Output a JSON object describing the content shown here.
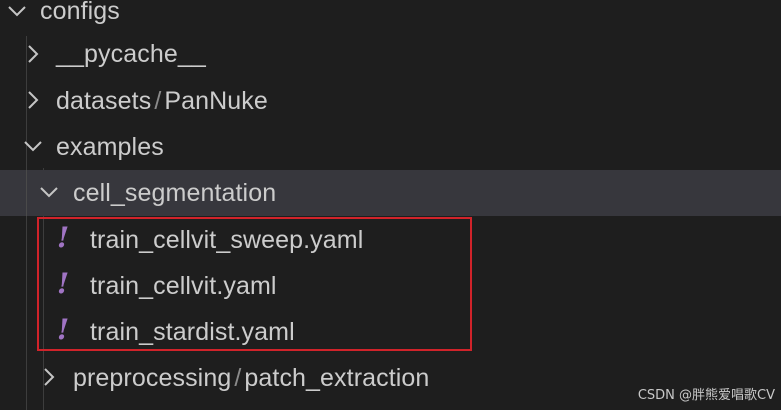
{
  "explorer": {
    "configs_label": "configs",
    "pycache_label": "__pycache__",
    "datasets": {
      "parent": "datasets",
      "separator": "/",
      "child": "PanNuke"
    },
    "examples_label": "examples",
    "cell_segmentation_label": "cell_segmentation",
    "files": [
      {
        "label": "train_cellvit_sweep.yaml",
        "icon": "yaml-icon",
        "icon_glyph": "!"
      },
      {
        "label": "train_cellvit.yaml",
        "icon": "yaml-icon",
        "icon_glyph": "!"
      },
      {
        "label": "train_stardist.yaml",
        "icon": "yaml-icon",
        "icon_glyph": "!"
      }
    ],
    "preprocessing": {
      "parent": "preprocessing",
      "separator": "/",
      "child": "patch_extraction"
    },
    "selected_item": "cell_segmentation"
  },
  "annotation": {
    "box_color": "#d1232a"
  },
  "colors": {
    "background": "#1e1e1e",
    "selected_background": "#37373d",
    "text": "#cccccc",
    "yaml_icon": "#a074c4"
  },
  "watermark": "CSDN @胖熊爱唱歌CV"
}
